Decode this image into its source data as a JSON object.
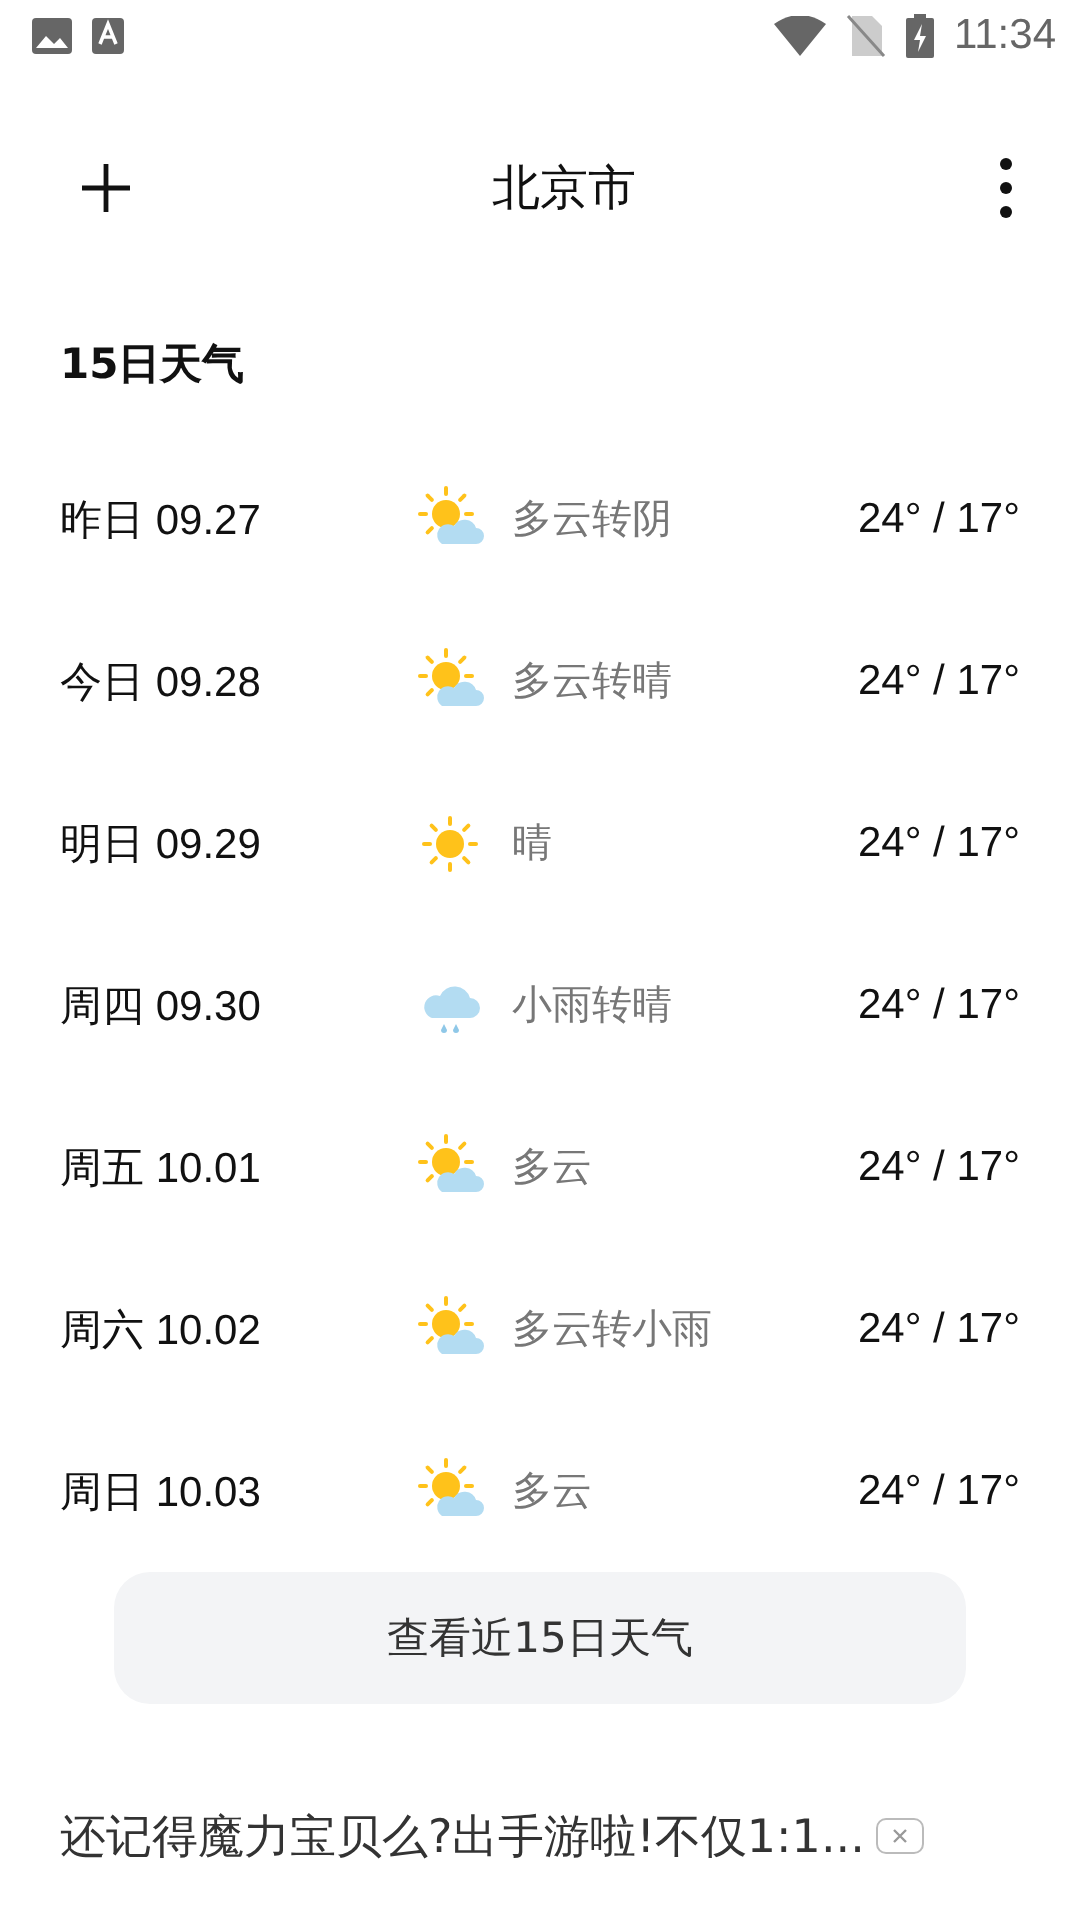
{
  "status_bar": {
    "time": "11:34"
  },
  "header": {
    "title": "北京市"
  },
  "section_title": "15日天气",
  "days": [
    {
      "date": "昨日 09.27",
      "kind": "partly_cloudy",
      "condition": "多云转阴",
      "temps": "24° / 17°"
    },
    {
      "date": "今日 09.28",
      "kind": "partly_cloudy",
      "condition": "多云转晴",
      "temps": "24° / 17°"
    },
    {
      "date": "明日 09.29",
      "kind": "sunny",
      "condition": "晴",
      "temps": "24° / 17°"
    },
    {
      "date": "周四 09.30",
      "kind": "rain",
      "condition": "小雨转晴",
      "temps": "24° / 17°"
    },
    {
      "date": "周五 10.01",
      "kind": "partly_cloudy",
      "condition": "多云",
      "temps": "24° / 17°"
    },
    {
      "date": "周六 10.02",
      "kind": "partly_cloudy",
      "condition": "多云转小雨",
      "temps": "24° / 17°"
    },
    {
      "date": "周日 10.03",
      "kind": "partly_cloudy",
      "condition": "多云",
      "temps": "24° / 17°"
    }
  ],
  "more_button": "查看近15日天气",
  "ad": {
    "text": "还记得魔力宝贝么?出手游啦!不仅1:1..."
  }
}
